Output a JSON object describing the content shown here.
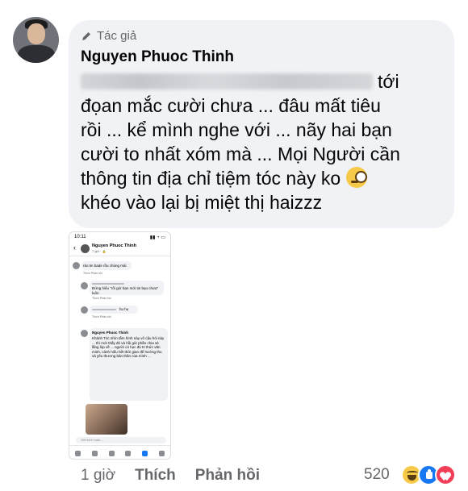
{
  "comment": {
    "author_badge": "Tác giả",
    "author_badge_icon": "pencil-icon",
    "author_name": "Nguyen Phuoc Thinh",
    "text_lines": [
      "tới",
      "đọan mắc cười chưa ... đâu mất tiêu",
      "rồi ... kể mình nghe với ... nãy hai bạn",
      "cười to nhất xóm mà ... Mọi Người cần",
      "thông tin địa chỉ tiệm tóc này ko",
      "khéo vào lại bị miệt thị haizzz"
    ],
    "emoji": "face-with-monocle"
  },
  "screenshot": {
    "status_time": "10:11",
    "header_name": "Nguyen Phuoc Thinh",
    "header_sub": "7 giờ · 🔒",
    "reply1": "rảo tin bade rồu chúng mài",
    "reply2": "Đừng hiểu \"rồi giờ bạn mới tin bạo chưa\" luôn",
    "reply3": "hu hu",
    "author_tag": "Nguyen Phuoc Thinh",
    "long_comment": "Khánh Tóc nhìn tấm hình này vô cậu hỏi này ... thì mới thấy đó và hồi giờ phần chia sẻ lắng lòp về ... người có học đủ tri thức văn minh, cánh hiểu hết thời gian để hướng thu và yêu thương bản thân của mình ...",
    "input_placeholder": "Viết bình luận...",
    "meta_actions": "Thích   Phản hồi"
  },
  "actions": {
    "time": "1 giờ",
    "like": "Thích",
    "reply": "Phản hồi",
    "reaction_count": "520"
  },
  "reactions": [
    "haha-icon",
    "like-icon",
    "love-icon"
  ],
  "colors": {
    "bubble_bg": "#f0f2f5",
    "meta_text": "#65676b",
    "like_blue": "#1877f2",
    "love_red": "#f33e58"
  }
}
